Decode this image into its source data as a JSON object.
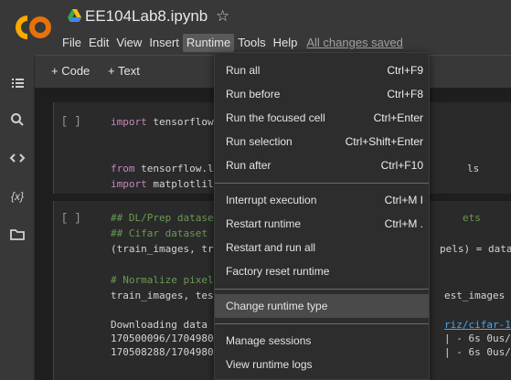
{
  "header": {
    "notebook_title": "EE104Lab8.ipynb",
    "menus": [
      "File",
      "Edit",
      "View",
      "Insert",
      "Runtime",
      "Tools",
      "Help"
    ],
    "active_menu": "Runtime",
    "save_status": "All changes saved"
  },
  "toolbar": {
    "code_label": "+ Code",
    "text_label": "+ Text"
  },
  "sidebar": {
    "icons": [
      "toc-icon",
      "search-icon",
      "code-snippets-icon",
      "variables-icon",
      "files-icon"
    ],
    "variables_glyph": "{x}"
  },
  "cells": [
    {
      "bracket": "[ ]",
      "lines": [
        {
          "kw": "import",
          "rest": " tensorflow"
        },
        {
          "kw": "",
          "rest": ""
        },
        {
          "kw": "from",
          "rest": " tensorflow.l",
          "tail": "ls"
        },
        {
          "kw": "import",
          "rest": " matplotlil"
        }
      ]
    },
    {
      "bracket": "[ ]",
      "lines": [
        {
          "comment": "## DL/Prep datase",
          "tail": "ets"
        },
        {
          "comment": "## Cifar dataset"
        },
        {
          "code": "(train_images, tr",
          "tail": "pels) = datas"
        },
        {
          "code": ""
        },
        {
          "comment": "# Normalize pixel"
        },
        {
          "code": "train_images, tes",
          "tail": "est_images /"
        }
      ],
      "output": [
        {
          "left": "Downloading data",
          "link": "riz/cifar-10-"
        },
        {
          "left": "170500096/1704980",
          "tail": "| - 6s 0us/st"
        },
        {
          "left": "170508288/1704980",
          "tail": "| - 6s 0us/st"
        }
      ]
    }
  ],
  "runtime_menu": {
    "items": [
      {
        "label": "Run all",
        "shortcut": "Ctrl+F9"
      },
      {
        "label": "Run before",
        "shortcut": "Ctrl+F8"
      },
      {
        "label": "Run the focused cell",
        "shortcut": "Ctrl+Enter"
      },
      {
        "label": "Run selection",
        "shortcut": "Ctrl+Shift+Enter"
      },
      {
        "label": "Run after",
        "shortcut": "Ctrl+F10"
      },
      {
        "label": "Interrupt execution",
        "shortcut": "Ctrl+M I"
      },
      {
        "label": "Restart runtime",
        "shortcut": "Ctrl+M ."
      },
      {
        "label": "Restart and run all",
        "shortcut": ""
      },
      {
        "label": "Factory reset runtime",
        "shortcut": ""
      },
      {
        "label": "Change runtime type",
        "shortcut": "",
        "highlighted": true
      },
      {
        "label": "Manage sessions",
        "shortcut": ""
      },
      {
        "label": "View runtime logs",
        "shortcut": ""
      }
    ]
  },
  "colors": {
    "accent_orange": "#f9ab00",
    "menu_bg": "#2d2d2d",
    "highlight": "#4a4a4a",
    "link": "#4aa3f0"
  }
}
